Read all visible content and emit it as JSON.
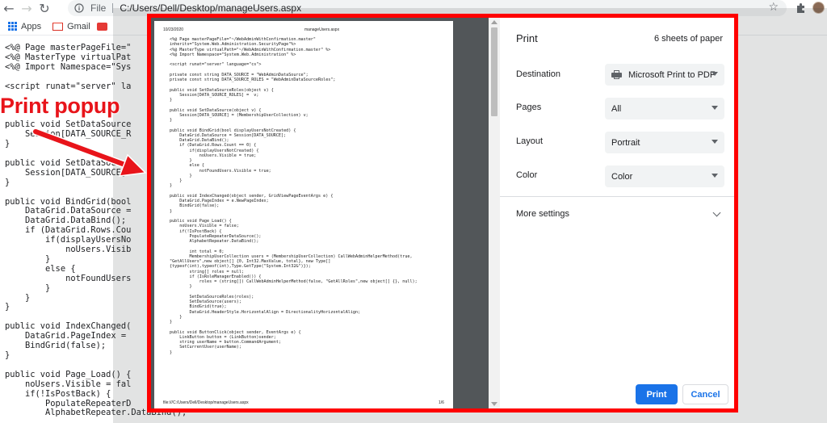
{
  "browser": {
    "scheme": "File",
    "url": "C:/Users/Dell/Desktop/manageUsers.aspx",
    "bookmarks": [
      "Apps",
      "Gmail"
    ]
  },
  "annotation": {
    "label": "Print popup",
    "color": "#e8141a"
  },
  "background_code": {
    "lines": [
      "<%@ Page masterPageFile=\"",
      "<%@ MasterType virtualPat",
      "<%@ Import Namespace=\"Sys",
      "",
      "<script runat=\"server\" la",
      "",
      "",
      "",
      "public void SetDataSource",
      "    Session[DATA_SOURCE_R",
      "}",
      "",
      "public void SetDataSource",
      "    Session[DATA_SOURCE]",
      "}",
      "",
      "public void BindGrid(bool",
      "    DataGrid.DataSource =",
      "    DataGrid.DataBind();",
      "    if (DataGrid.Rows.Cou",
      "        if(displayUsersNo",
      "            noUsers.Visib",
      "        }",
      "        else {",
      "            notFoundUsers",
      "        }",
      "    }",
      "}",
      "",
      "public void IndexChanged(",
      "    DataGrid.PageIndex =",
      "    BindGrid(false);",
      "}",
      "",
      "public void Page_Load() {",
      "    noUsers.Visible = fal",
      "    if(!IsPostBack) {",
      "        PopulateRepeaterD",
      "        AlphabetRepeater.DataBind();"
    ]
  },
  "print_dialog": {
    "title": "Print",
    "sheets": "6 sheets of paper",
    "destination_label": "Destination",
    "destination_value": "Microsoft Print to PDF",
    "pages_label": "Pages",
    "pages_value": "All",
    "layout_label": "Layout",
    "layout_value": "Portrait",
    "color_label": "Color",
    "color_value": "Color",
    "more_settings": "More settings",
    "print_button": "Print",
    "cancel_button": "Cancel",
    "accent_color": "#1a73e8",
    "highlight_border_color": "#ff0000"
  },
  "preview_page": {
    "header_date": "10/23/2020",
    "header_title": "manageUsers.aspx",
    "footer_path": "file:///C:/Users/Dell/Desktop/manageUsers.aspx",
    "footer_page": "1/6",
    "code": "<%@ Page masterPageFile=\"~/WebAdminWithConfirmation.master\"\ninherits=\"System.Web.Administration.SecurityPage\"%>\n<%@ MasterType virtualPath=\"~/WebAdminWithConfirmation.master\" %>\n<%@ Import Namespace=\"System.Web.Administration\" %>\n\n<script runat=\"server\" language=\"cs\">\n\nprivate const string DATA_SOURCE = \"WebAdminDataSource\";\nprivate const string DATA_SOURCE_ROLES = \"WebAdminDataSourceRoles\";\n\npublic void SetDataSourceRoles(object v) {\n    Session[DATA_SOURCE_ROLES] =  v;\n}\n\npublic void SetDataSource(object v) {\n    Session[DATA_SOURCE] = (MembershipUserCollection) v;\n}\n\npublic void BindGrid(bool displayUsersNotCreated) {\n    DataGrid.DataSource = Session[DATA_SOURCE];\n    DataGrid.DataBind();\n    if (DataGrid.Rows.Count == 0) {\n        if(displayUsersNotCreated) {\n            noUsers.Visible = true;\n        }\n        else {\n            notFoundUsers.Visible = true;\n        }\n    }\n}\n\npublic void IndexChanged(object sender, GridViewPageEventArgs e) {\n    DataGrid.PageIndex = e.NewPageIndex;\n    BindGrid(false);\n}\n\npublic void Page_Load() {\n    noUsers.Visible = false;\n    if(!IsPostBack) {\n        PopulateRepeaterDataSource();\n        AlphabetRepeater.DataBind();\n\n        int total = 0;\n        MembershipUserCollection users = (MembershipUserCollection) CallWebAdminHelperMethod(true,\n\"GetAllUsers\",new object[] {0, Int32.MaxValue, total}, new Type[]\n{typeof(int),typeof(int),Type.GetType(\"System.Int32&\")});\n        string[] roles = null;\n        if (IsRoleManagerEnabled()) {\n            roles = (string[]) CallWebAdminHelperMethod(false, \"GetAllRoles\",new object[] {}, null);\n        }\n\n        SetDataSourceRoles(roles);\n        SetDataSource(users);\n        BindGrid(true);\n        DataGrid.HeaderStyle.HorizontalAlign = DirectionalityHorizontalAlign;\n    }\n}\n\npublic void ButtonClick(object sender, EventArgs e) {\n    LinkButton button = (LinkButton)sender;\n    string userName = button.CommandArgument;\n    SetCurrentUser(userName);\n}"
  }
}
